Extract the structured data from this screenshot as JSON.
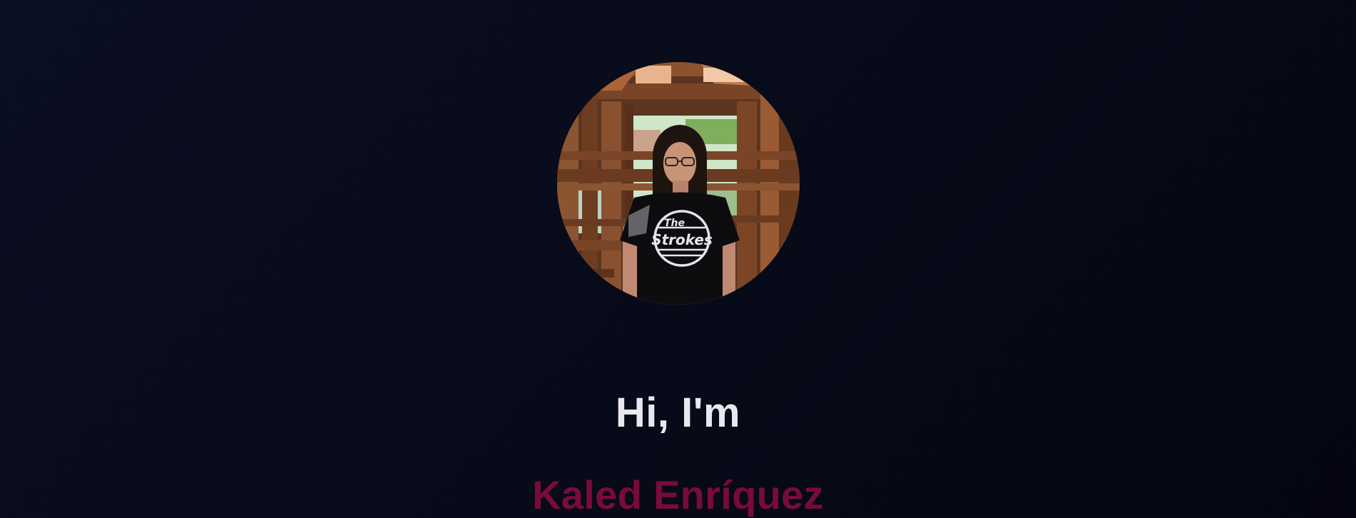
{
  "hero": {
    "greeting": "Hi, I'm",
    "name": "Kaled Enríquez",
    "avatar_alt": "Profile photo of Kaled Enríquez",
    "shirt_text_top": "The",
    "shirt_text_main": "Strokes"
  },
  "colors": {
    "background": "#080b1a",
    "greeting": "#e8e8ee",
    "name": "#7a0a3c"
  }
}
